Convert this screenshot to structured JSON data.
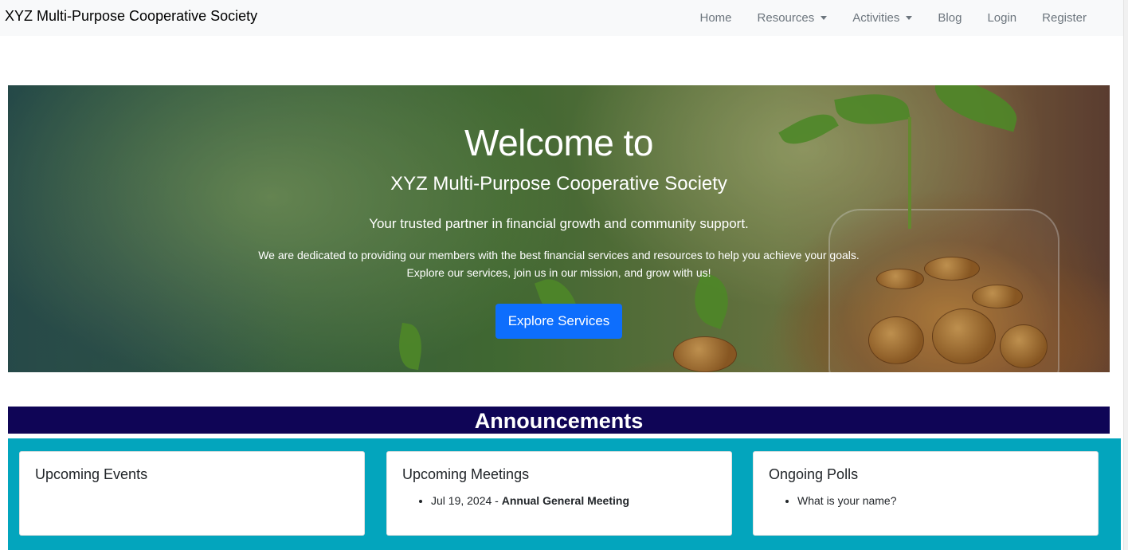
{
  "navbar": {
    "brand": "XYZ Multi-Purpose Cooperative Society",
    "items": [
      {
        "label": "Home",
        "dropdown": false
      },
      {
        "label": "Resources",
        "dropdown": true
      },
      {
        "label": "Activities",
        "dropdown": true
      },
      {
        "label": "Blog",
        "dropdown": false
      },
      {
        "label": "Login",
        "dropdown": false
      },
      {
        "label": "Register",
        "dropdown": false
      }
    ]
  },
  "hero": {
    "title": "Welcome to",
    "subtitle": "XYZ Multi-Purpose Cooperative Society",
    "tagline": "Your trusted partner in financial growth and community support.",
    "description": "We are dedicated to providing our members with the best financial services and resources to help you achieve your goals. Explore our services, join us in our mission, and grow with us!",
    "button_label": "Explore Services"
  },
  "announcements": {
    "heading": "Announcements",
    "cards": [
      {
        "title": "Upcoming Events",
        "items": []
      },
      {
        "title": "Upcoming Meetings",
        "items": [
          {
            "date": "Jul 19, 2024",
            "separator": " - ",
            "name": "Annual General Meeting"
          }
        ]
      },
      {
        "title": "Ongoing Polls",
        "items": [
          {
            "text": "What is your name?"
          }
        ]
      }
    ]
  },
  "colors": {
    "navbar_bg": "#f8f9fa",
    "primary_button": "#0d6efd",
    "announcement_bar": "#0f0556",
    "announcement_section": "#03a5bd"
  }
}
